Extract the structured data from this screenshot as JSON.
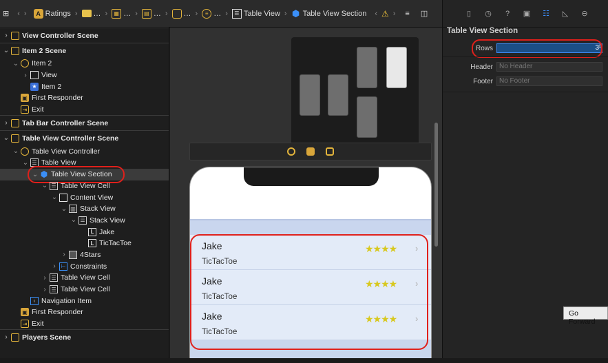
{
  "jumpbar": {
    "items": [
      {
        "label": "Ratings",
        "icon": "project-icon"
      },
      {
        "label": "…",
        "icon": "folder-icon"
      },
      {
        "label": "…",
        "icon": "storyboard-icon"
      },
      {
        "label": "…",
        "icon": "file-icon"
      },
      {
        "label": "…",
        "icon": "scene-icon"
      },
      {
        "label": "…",
        "icon": "controller-icon"
      },
      {
        "label": "Table View",
        "icon": "table-icon"
      },
      {
        "label": "Table View Section",
        "icon": "cube-icon"
      }
    ]
  },
  "outline": {
    "rows": [
      {
        "label": "View Controller Scene",
        "indent": 0,
        "icon": "scene",
        "disc": ">",
        "scene": true
      },
      {
        "label": "Item 2 Scene",
        "indent": 0,
        "icon": "scene",
        "disc": "v",
        "scene": true
      },
      {
        "label": "Item 2",
        "indent": 1,
        "icon": "ctrl",
        "disc": "v"
      },
      {
        "label": "View",
        "indent": 2,
        "icon": "view",
        "disc": ">"
      },
      {
        "label": "Item 2",
        "indent": 2,
        "icon": "star",
        "disc": ""
      },
      {
        "label": "First Responder",
        "indent": 1,
        "icon": "resp",
        "disc": ""
      },
      {
        "label": "Exit",
        "indent": 1,
        "icon": "exit",
        "disc": ""
      },
      {
        "label": "Tab Bar Controller Scene",
        "indent": 0,
        "icon": "scene",
        "disc": ">",
        "scene": true
      },
      {
        "label": "Table View Controller Scene",
        "indent": 0,
        "icon": "scene",
        "disc": "v",
        "scene": true
      },
      {
        "label": "Table View Controller",
        "indent": 1,
        "icon": "ctrl",
        "disc": "v"
      },
      {
        "label": "Table View",
        "indent": 2,
        "icon": "list",
        "disc": "v"
      },
      {
        "label": "Table View Section",
        "indent": 3,
        "icon": "cube",
        "disc": "v",
        "selected": true
      },
      {
        "label": "Table View Cell",
        "indent": 4,
        "icon": "list",
        "disc": "v"
      },
      {
        "label": "Content View",
        "indent": 5,
        "icon": "view",
        "disc": "v"
      },
      {
        "label": "Stack View",
        "indent": 6,
        "icon": "hstack",
        "disc": "v"
      },
      {
        "label": "Stack View",
        "indent": 7,
        "icon": "list",
        "disc": "v"
      },
      {
        "label": "Jake",
        "indent": 8,
        "icon": "label",
        "disc": ""
      },
      {
        "label": "TicTacToe",
        "indent": 8,
        "icon": "label",
        "disc": ""
      },
      {
        "label": "4Stars",
        "indent": 6,
        "icon": "img",
        "disc": ">"
      },
      {
        "label": "Constraints",
        "indent": 5,
        "icon": "constr",
        "disc": ">"
      },
      {
        "label": "Table View Cell",
        "indent": 4,
        "icon": "list",
        "disc": ">"
      },
      {
        "label": "Table View Cell",
        "indent": 4,
        "icon": "list",
        "disc": ">"
      },
      {
        "label": "Navigation Item",
        "indent": 2,
        "icon": "nav",
        "disc": ""
      },
      {
        "label": "First Responder",
        "indent": 1,
        "icon": "resp",
        "disc": ""
      },
      {
        "label": "Exit",
        "indent": 1,
        "icon": "exit",
        "disc": ""
      },
      {
        "label": "Players Scene",
        "indent": 0,
        "icon": "scene",
        "disc": ">",
        "scene": true
      }
    ]
  },
  "canvas": {
    "cells": [
      {
        "name": "Jake",
        "game": "TicTacToe",
        "rating": 4
      },
      {
        "name": "Jake",
        "game": "TicTacToe",
        "rating": 4
      },
      {
        "name": "Jake",
        "game": "TicTacToe",
        "rating": 4
      }
    ]
  },
  "inspector": {
    "title": "Table View Section",
    "rows_label": "Rows",
    "rows_value": "3",
    "header_label": "Header",
    "header_placeholder": "No Header",
    "footer_label": "Footer",
    "footer_placeholder": "No Footer"
  },
  "tooltip": "Go Forward",
  "colors": {
    "accent": "#3d8cf5",
    "highlight": "#e0201b",
    "star": "#d8c81e"
  }
}
